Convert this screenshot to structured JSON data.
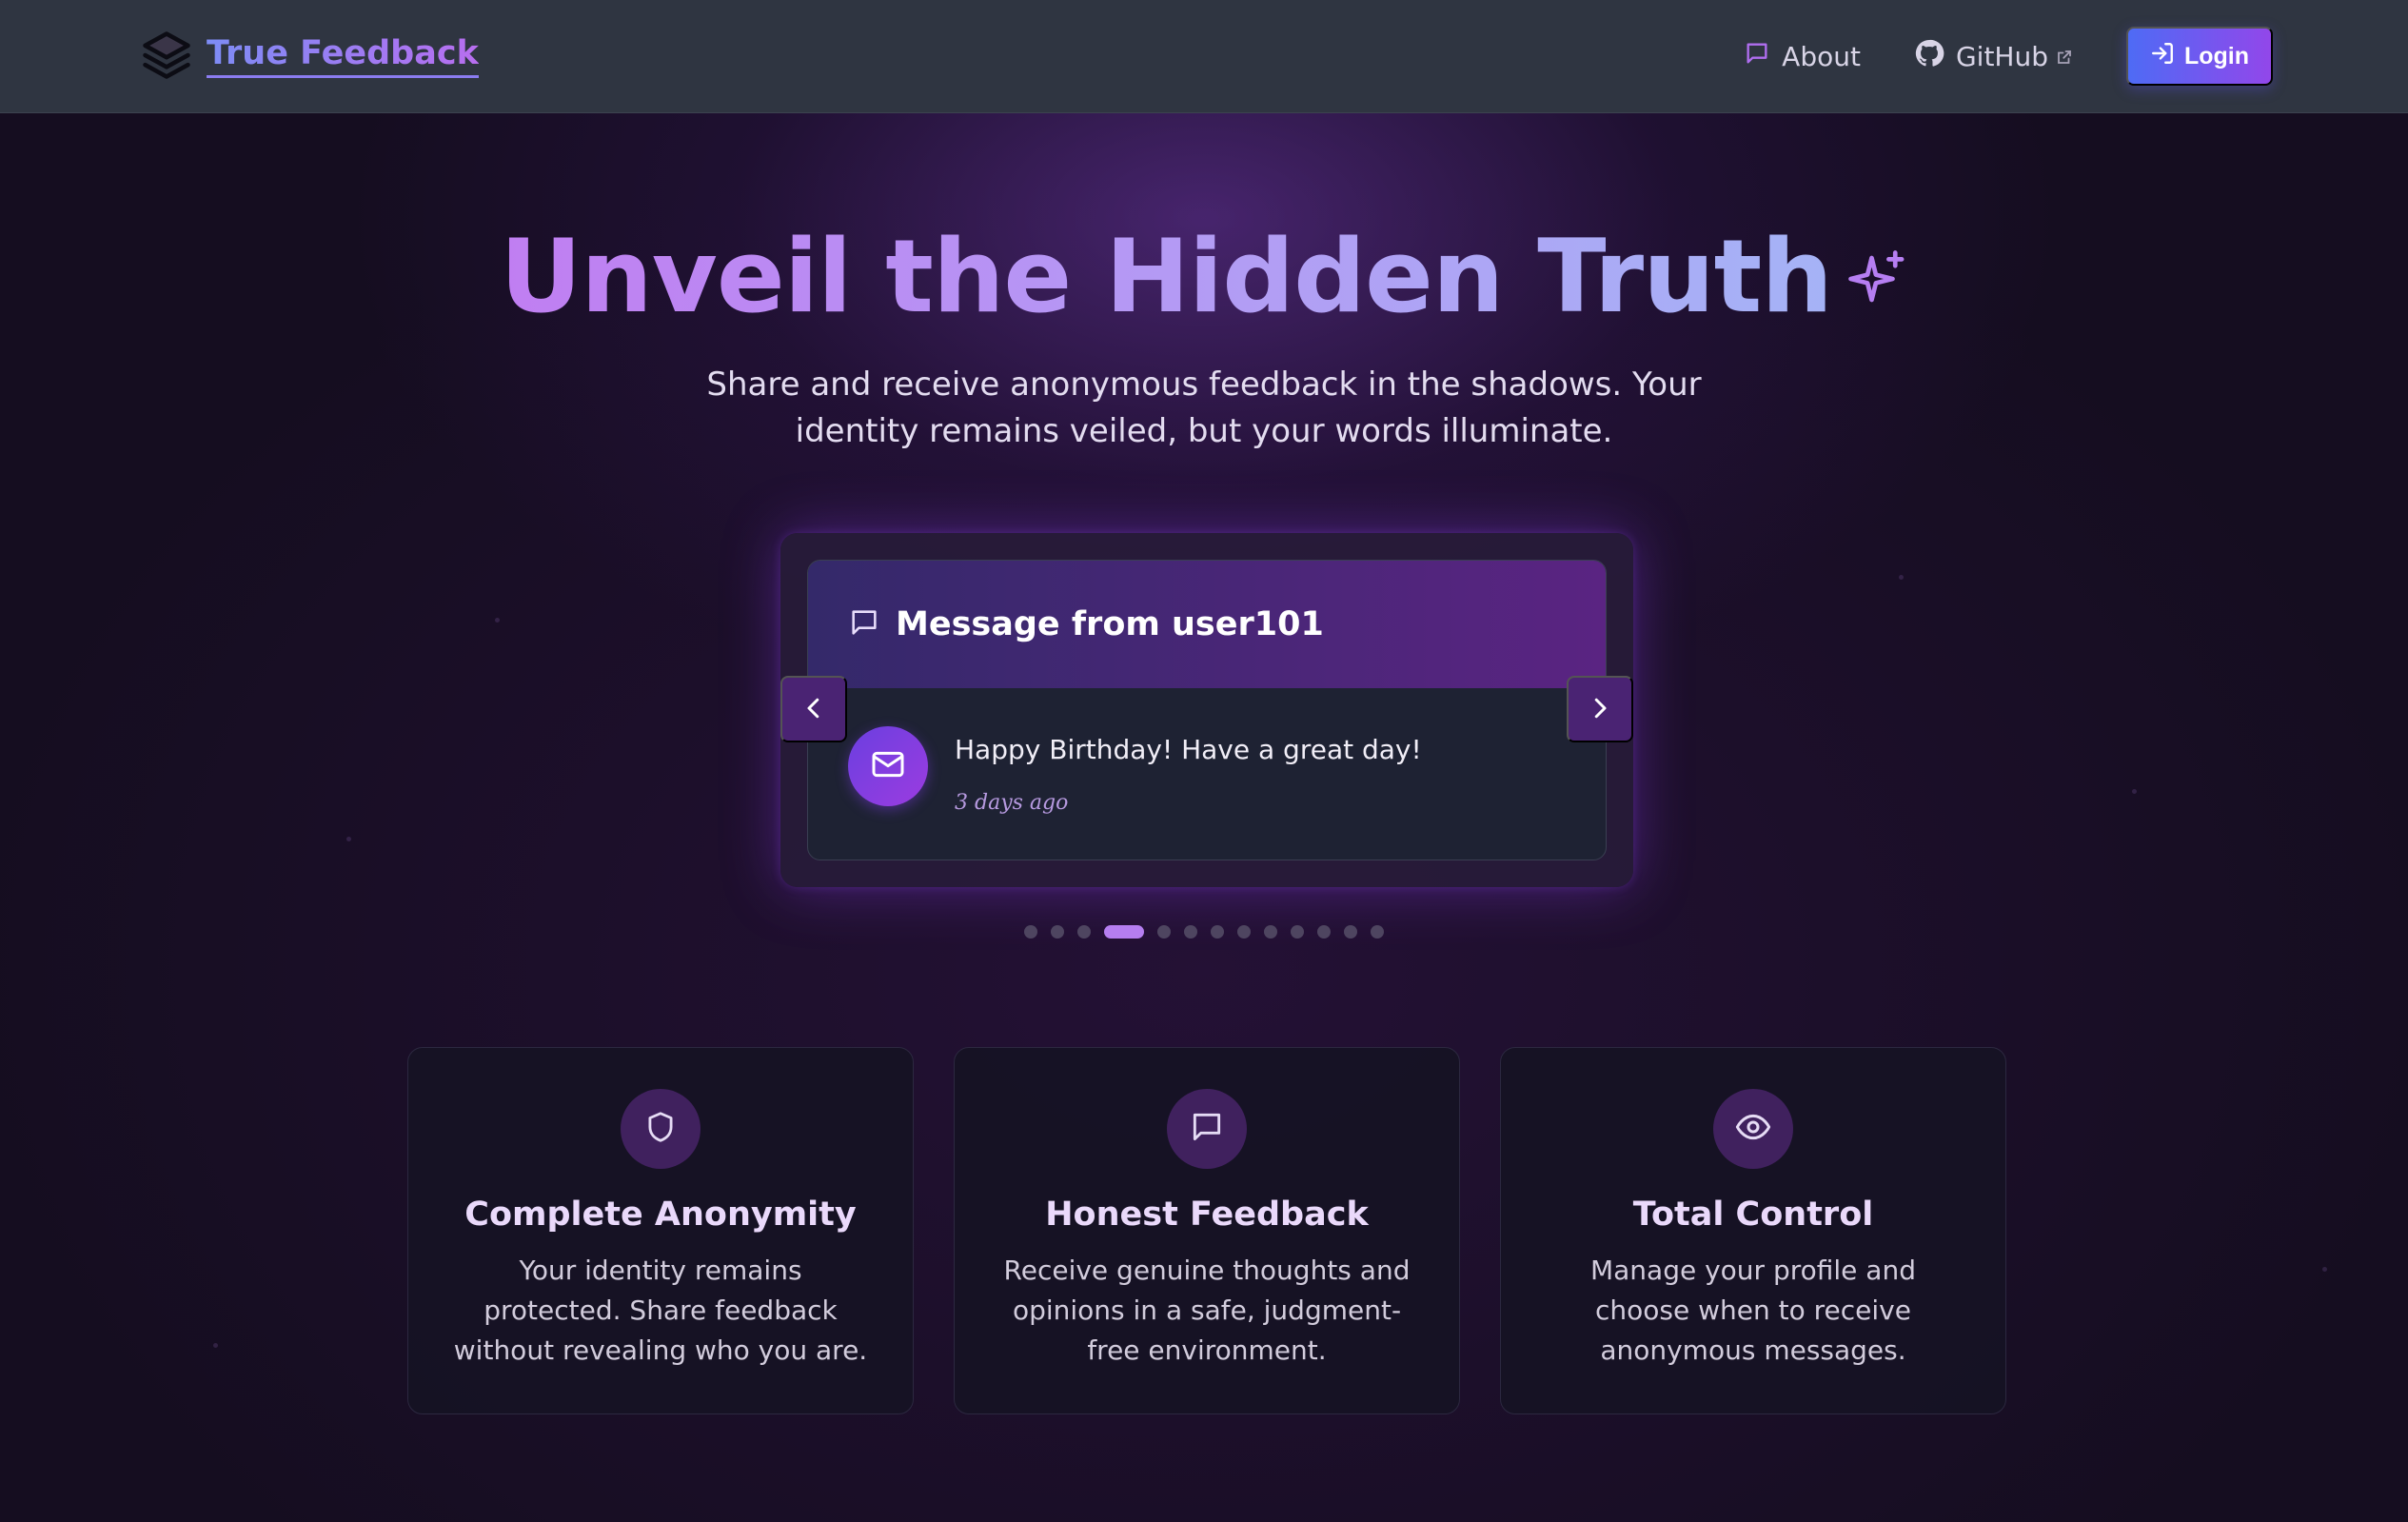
{
  "nav": {
    "brand": "True Feedback",
    "about": "About",
    "github": "GitHub",
    "login": "Login"
  },
  "hero": {
    "title": "Unveil the Hidden Truth",
    "subtitle": "Share and receive anonymous feedback in the shadows. Your identity remains veiled, but your words illuminate."
  },
  "carousel": {
    "title": "Message from user101",
    "message": "Happy Birthday! Have a great day!",
    "time": "3 days ago",
    "dot_count": 13,
    "active_index": 3
  },
  "features": [
    {
      "icon": "shield-icon",
      "title": "Complete Anonymity",
      "text": "Your identity remains protected. Share feedback without revealing who you are."
    },
    {
      "icon": "message-icon",
      "title": "Honest Feedback",
      "text": "Receive genuine thoughts and opinions in a safe, judgment-free environment."
    },
    {
      "icon": "eye-icon",
      "title": "Total Control",
      "text": "Manage your profile and choose when to receive anonymous messages."
    }
  ],
  "colors": {
    "accent": "#b57ef0",
    "nav_bg": "#2f3541",
    "page_bg": "#150d20",
    "login_from": "#4e6bf5",
    "login_to": "#9247ea"
  }
}
